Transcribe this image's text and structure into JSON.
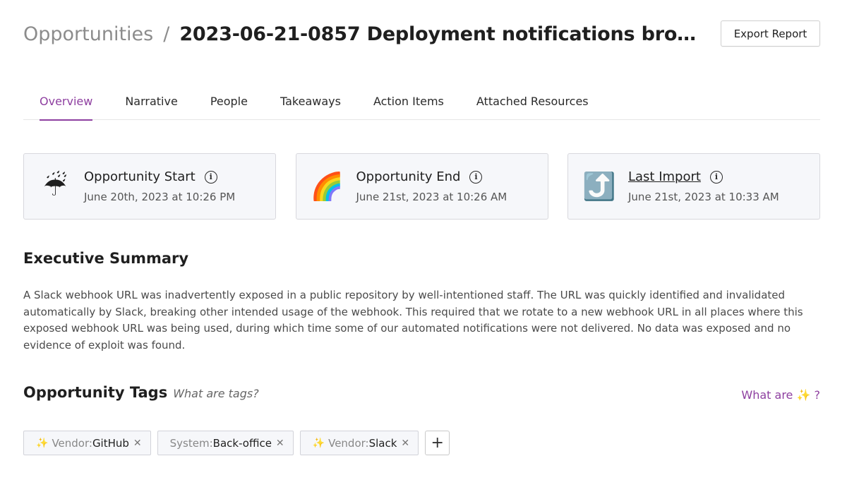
{
  "breadcrumb": {
    "parent": "Opportunities",
    "separator": "/",
    "current": "2023-06-21-0857 Deployment notifications bro…"
  },
  "export_button": {
    "label": "Export Report"
  },
  "tabs": [
    {
      "label": "Overview",
      "active": true
    },
    {
      "label": "Narrative"
    },
    {
      "label": "People"
    },
    {
      "label": "Takeaways"
    },
    {
      "label": "Action Items"
    },
    {
      "label": "Attached Resources"
    }
  ],
  "cards": [
    {
      "icon": "umbrella-rain-icon",
      "glyph": "☔",
      "title": "Opportunity Start",
      "subtitle": "June 20th, 2023 at 10:26 PM"
    },
    {
      "icon": "rainbow-icon",
      "glyph": "🌈",
      "title": "Opportunity End",
      "subtitle": "June 21st, 2023 at 10:26 AM"
    },
    {
      "icon": "right-arrow-curving-up-icon",
      "glyph": "⤴️",
      "title": "Last Import",
      "subtitle": "June 21st, 2023 at 10:33 AM"
    }
  ],
  "executive_summary": {
    "heading": "Executive Summary",
    "body": "A Slack webhook URL was inadvertently exposed in a public repository by well-intentioned staff. The URL was quickly identified and invalidated automatically by Slack, breaking other intended usage of the webhook. This required that we rotate to a new webhook URL in all places where this exposed webhook URL was being used, during which time some of our automated notifications were not delivered. No data was exposed and no evidence of exploit was found."
  },
  "tags": {
    "heading": "Opportunity Tags",
    "hint": "What are tags?",
    "help_prefix": "What are",
    "help_sparkle": "✨",
    "help_suffix": "?",
    "items": [
      {
        "sparkle": "✨",
        "key": "Vendor:",
        "value": "GitHub",
        "remove": "✕"
      },
      {
        "sparkle": "",
        "key": "System:",
        "value": "Back-office",
        "remove": "✕"
      },
      {
        "sparkle": "✨",
        "key": "Vendor:",
        "value": "Slack",
        "remove": "✕"
      }
    ],
    "add_label": "+"
  },
  "colors": {
    "accent": "#8e3fa0",
    "card_bg": "#f6f7fa",
    "muted_text": "#8c8c8c"
  }
}
